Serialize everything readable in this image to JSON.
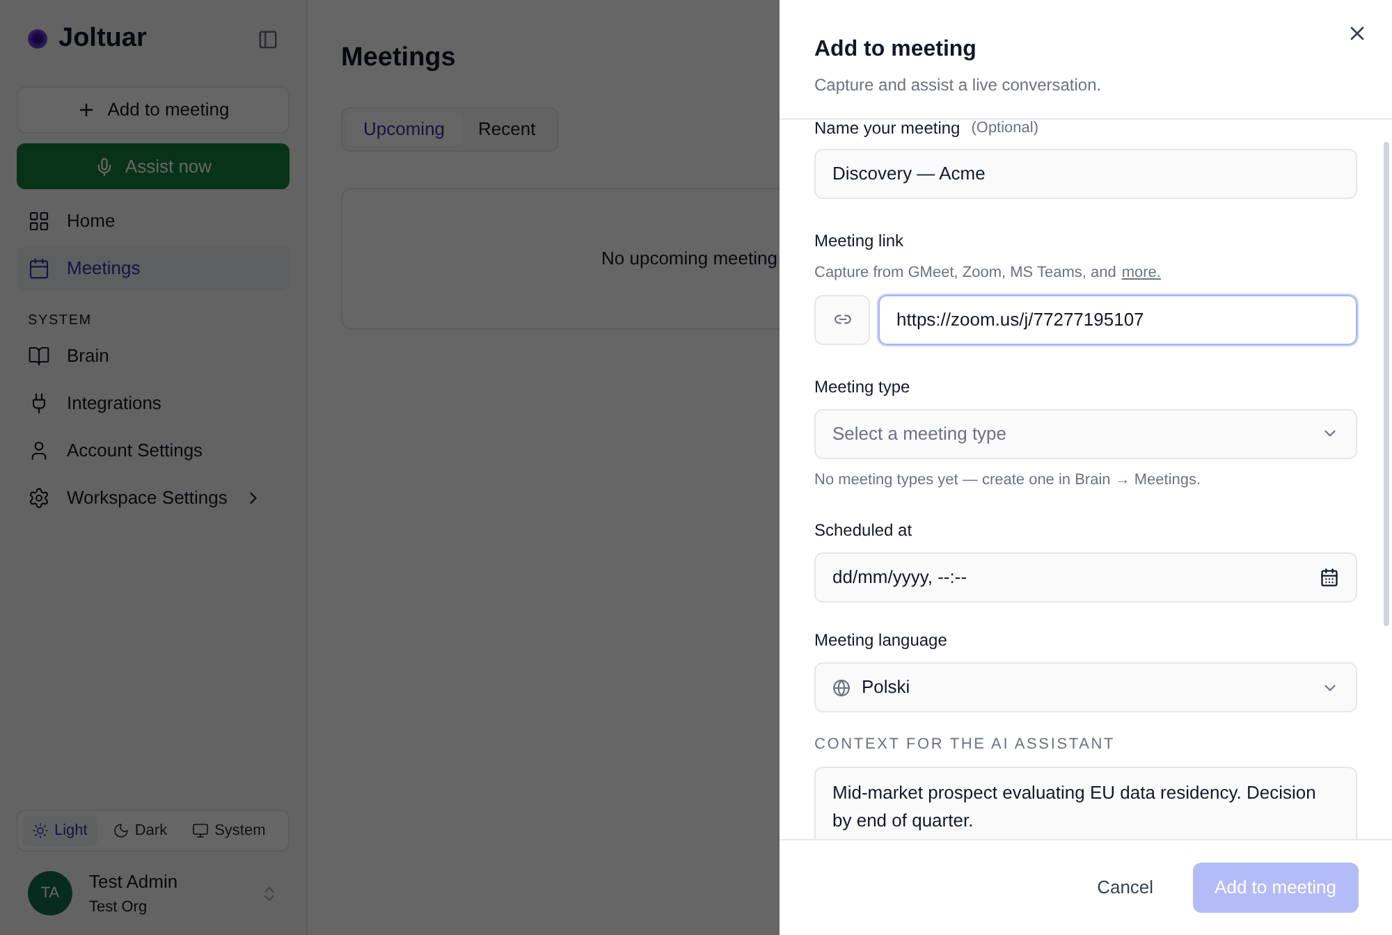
{
  "sidebar": {
    "brand": "Joltuar",
    "add_button": "Add to meeting",
    "assist_button": "Assist now",
    "items": [
      {
        "label": "Home",
        "selected": false
      },
      {
        "label": "Meetings",
        "selected": true
      }
    ],
    "section_title": "SYSTEM",
    "system_items": [
      {
        "label": "Brain",
        "has_submenu": false
      },
      {
        "label": "Integrations",
        "has_submenu": false
      },
      {
        "label": "Account Settings",
        "has_submenu": false
      },
      {
        "label": "Workspace Settings",
        "has_submenu": true
      }
    ],
    "theme_options": [
      {
        "label": "Light",
        "selected": true
      },
      {
        "label": "Dark",
        "selected": false
      },
      {
        "label": "System",
        "selected": false
      }
    ],
    "user": {
      "initials": "TA",
      "name": "Test Admin",
      "org": "Test Org"
    }
  },
  "main": {
    "title": "Meetings",
    "tabs": [
      {
        "label": "Upcoming",
        "selected": true
      },
      {
        "label": "Recent",
        "selected": false
      }
    ],
    "empty_message": "No upcoming meeting"
  },
  "drawer": {
    "title": "Add to meeting",
    "subtitle": "Capture and assist a live conversation.",
    "name_label": "Name your meeting",
    "name_optional": "(Optional)",
    "name_value": "Discovery — Acme",
    "link_label": "Meeting link",
    "link_help": "Capture from GMeet, Zoom, MS Teams, and",
    "link_more": "more.",
    "link_value": "https://zoom.us/j/77277195107",
    "type_label": "Meeting type",
    "type_placeholder": "Select a meeting type",
    "type_help": "No meeting types yet — create one in Brain → Meetings.",
    "scheduled_label": "Scheduled at",
    "scheduled_placeholder": "dd/mm/yyyy, --:--",
    "language_label": "Meeting language",
    "language_value": "Polski",
    "context_label": "CONTEXT FOR THE AI ASSISTANT",
    "context_value": "Mid-market prospect evaluating EU data residency. Decision by end of quarter.",
    "cancel_button": "Cancel",
    "submit_button": "Add to meeting",
    "submit_disabled": true
  }
}
